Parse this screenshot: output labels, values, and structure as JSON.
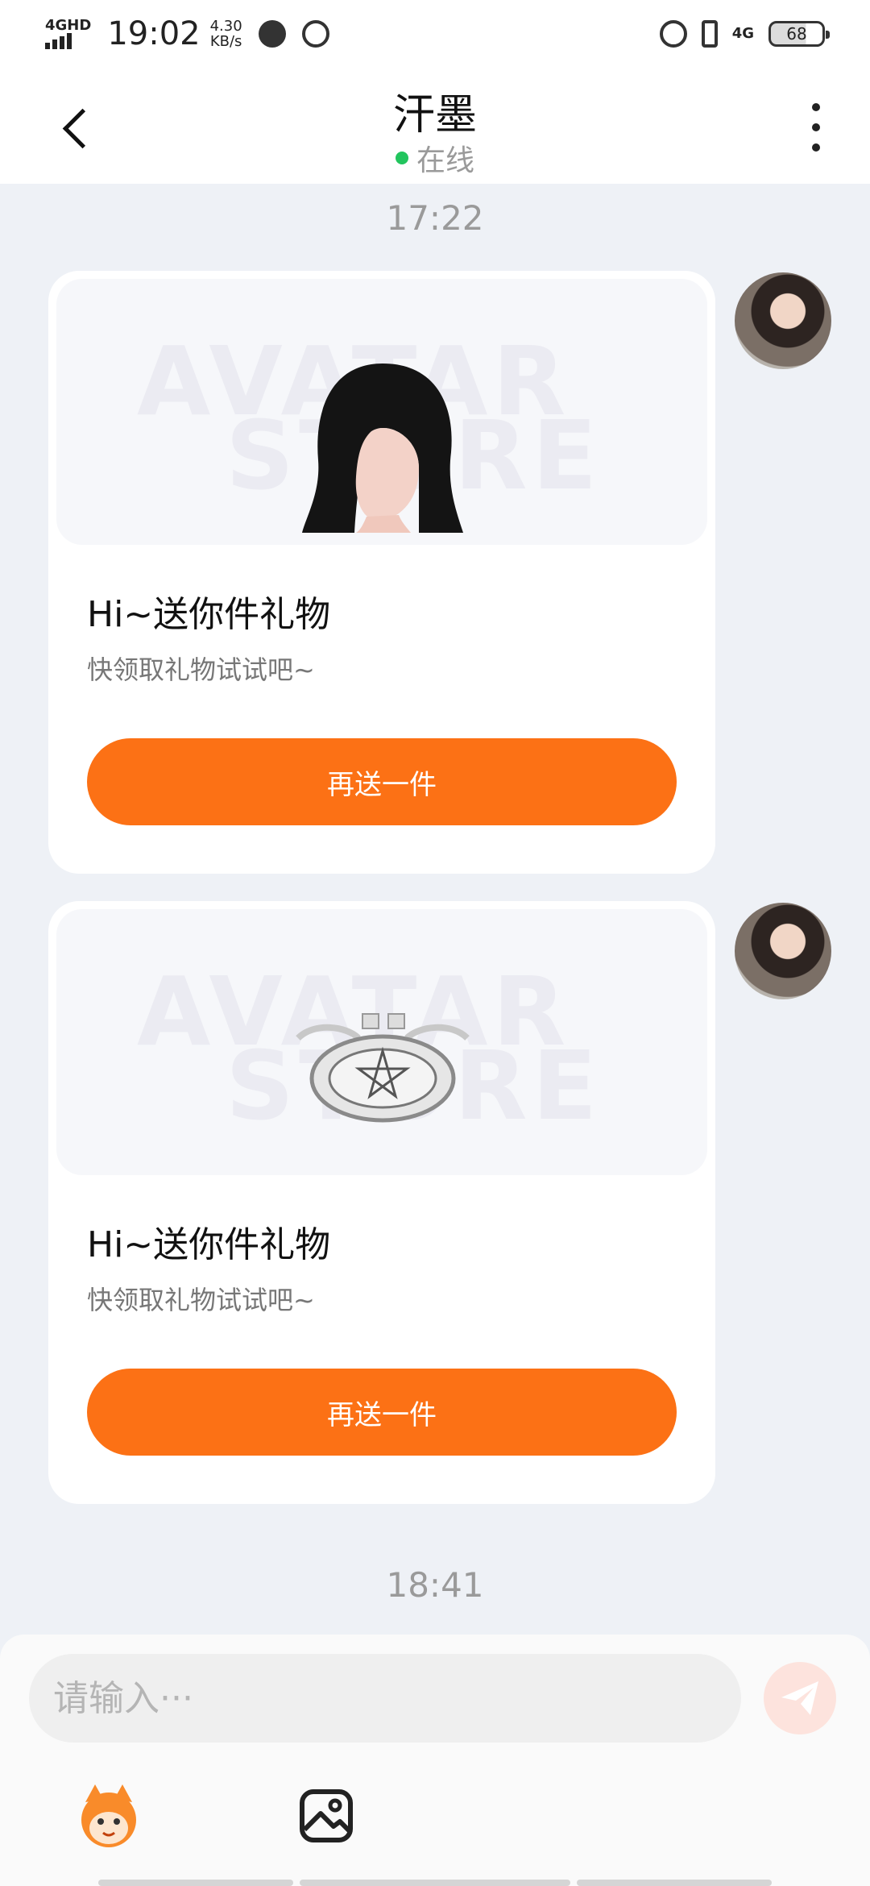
{
  "status_bar": {
    "network": "4GHD",
    "time": "19:02",
    "speed_value": "4.30",
    "speed_unit": "KB/s",
    "signal_right": "4G",
    "battery": "68"
  },
  "header": {
    "title": "汗墨",
    "status": "在线"
  },
  "messages": [
    {
      "timestamp": "17:22",
      "watermark_line1": "AVATAR",
      "watermark_line2": "STORE",
      "title": "Hi~送你件礼物",
      "description": "快领取礼物试试吧~",
      "button_label": "再送一件",
      "gift": "hair"
    },
    {
      "watermark_line1": "AVATAR",
      "watermark_line2": "STORE",
      "title": "Hi~送你件礼物",
      "description": "快领取礼物试试吧~",
      "button_label": "再送一件",
      "gift": "pentagram-ring"
    }
  ],
  "second_timestamp": "18:41",
  "input": {
    "placeholder": "请输入···"
  },
  "colors": {
    "accent": "#fc7115",
    "online": "#22c55e",
    "background": "#eef1f6"
  },
  "icons": {
    "back": "back-arrow-icon",
    "more": "more-vertical-icon",
    "send": "send-icon",
    "emoji": "mascot-emoji-icon",
    "image": "image-icon"
  }
}
